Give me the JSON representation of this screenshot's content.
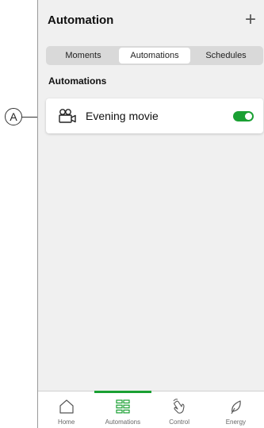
{
  "callout": {
    "label": "A"
  },
  "header": {
    "title": "Automation",
    "add_symbol": "+"
  },
  "segments": [
    {
      "label": "Moments",
      "active": false
    },
    {
      "label": "Automations",
      "active": true
    },
    {
      "label": "Schedules",
      "active": false
    }
  ],
  "section": {
    "title": "Automations"
  },
  "automations": [
    {
      "label": "Evening movie",
      "icon": "movie-camera-icon",
      "enabled": true
    }
  ],
  "nav": [
    {
      "label": "Home",
      "icon": "home-icon",
      "active": false
    },
    {
      "label": "Automations",
      "icon": "grid-icon",
      "active": true
    },
    {
      "label": "Control",
      "icon": "hand-icon",
      "active": false
    },
    {
      "label": "Energy",
      "icon": "leaf-icon",
      "active": false
    }
  ],
  "colors": {
    "accent": "#1aa033",
    "background": "#f0f0f0"
  }
}
